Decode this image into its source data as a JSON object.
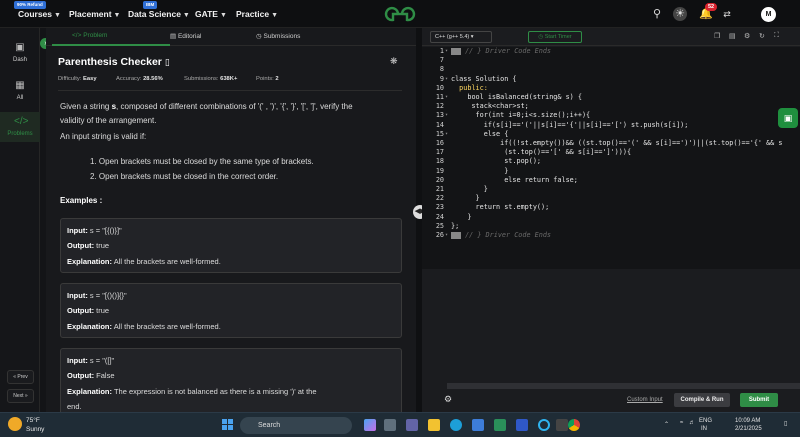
{
  "nav": {
    "courses": "Courses",
    "refund_badge": "90% Refund",
    "placement": "Placement",
    "data_science": "Data Science",
    "ibm_badge": "IBM",
    "gate": "GATE",
    "practice": "Practice",
    "notif_count": "52",
    "avatar": "M",
    "logo_text": "GfG"
  },
  "sidebar": {
    "dash": "Dash",
    "all": "All",
    "problems": "Problems",
    "prev": "« Prev",
    "next": "Next »"
  },
  "tabs": {
    "problem": "Problem",
    "editorial": "Editorial",
    "submissions": "Submissions"
  },
  "problem": {
    "title": "Parenthesis Checker",
    "difficulty_label": "Difficulty:",
    "difficulty": "Easy",
    "accuracy_label": "Accuracy:",
    "accuracy": "28.56%",
    "submissions_label": "Submissions:",
    "submissions": "638K+",
    "points_label": "Points:",
    "points": "2",
    "desc1": "Given a string",
    "desc1_var": "s",
    "desc1_rest": ", composed of different combinations of '(' , ')', '{', '}', '[', ']', verify the",
    "desc2": "validity of the arrangement.",
    "desc3": "An input string is valid if:",
    "rules": [
      "1. Open brackets must be closed by the same type of brackets.",
      "2. Open brackets must be closed in the correct order."
    ],
    "examples_heading": "Examples :",
    "examples": [
      {
        "input_label": "Input:",
        "input": "s = \"[{()}]\"",
        "output_label": "Output:",
        "output": "true",
        "expl_label": "Explanation:",
        "explanation": "All the brackets are well-formed."
      },
      {
        "input_label": "Input:",
        "input": "s = \"[()()]{}\"",
        "output_label": "Output:",
        "output": "true",
        "expl_label": "Explanation:",
        "explanation": "All the brackets are well-formed."
      },
      {
        "input_label": "Input:",
        "input": "s = \"([]\"",
        "output_label": "Output:",
        "output": "False",
        "expl_label": "Explanation:",
        "explanation": "The expression is not balanced as there is a missing ')' at the",
        "explanation2": "end."
      }
    ]
  },
  "editor": {
    "language": "C++ (g++ 5.4)",
    "timer": "Start Timer",
    "lines": [
      {
        "n": "1",
        "t": "// } Driver Code Ends",
        "cls": "cm",
        "fold": true,
        "hl": true
      },
      {
        "n": "7",
        "t": "",
        "cls": ""
      },
      {
        "n": "8",
        "t": "",
        "cls": ""
      },
      {
        "n": "9",
        "t": "class Solution {",
        "cls": "",
        "fold": true
      },
      {
        "n": "10",
        "t": "  public:",
        "cls": "kw"
      },
      {
        "n": "11",
        "t": "    bool isBalanced(string& s) {",
        "cls": "",
        "fold": true
      },
      {
        "n": "12",
        "t": "     stack<char>st;",
        "cls": ""
      },
      {
        "n": "13",
        "t": "      for(int i=0;i<s.size();i++){",
        "cls": "",
        "fold": true
      },
      {
        "n": "14",
        "t": "        if(s[i]=='('||s[i]=='{'||s[i]=='[') st.push(s[i]);",
        "cls": ""
      },
      {
        "n": "15",
        "t": "        else {",
        "cls": "",
        "fold": true
      },
      {
        "n": "16",
        "t": "            if((!st.empty())&& ((st.top()=='(' && s[i]==')')||(st.top()=='{' && s",
        "cls": ""
      },
      {
        "n": "17",
        "t": "             (st.top()=='[' && s[i]==']'))){",
        "cls": ""
      },
      {
        "n": "18",
        "t": "             st.pop();",
        "cls": ""
      },
      {
        "n": "19",
        "t": "             }",
        "cls": ""
      },
      {
        "n": "20",
        "t": "             else return false;",
        "cls": ""
      },
      {
        "n": "21",
        "t": "        }",
        "cls": ""
      },
      {
        "n": "22",
        "t": "      }",
        "cls": ""
      },
      {
        "n": "23",
        "t": "      return st.empty();",
        "cls": ""
      },
      {
        "n": "24",
        "t": "    }",
        "cls": ""
      },
      {
        "n": "25",
        "t": "};",
        "cls": ""
      },
      {
        "n": "26",
        "t": "// } Driver Code Ends",
        "cls": "cm",
        "fold": true,
        "hl": true
      }
    ],
    "custom_input": "Custom Input",
    "compile_run": "Compile & Run",
    "submit": "Submit"
  },
  "taskbar": {
    "temp": "75°F",
    "weather": "Sunny",
    "search": "Search",
    "lang1": "ENG",
    "lang2": "IN",
    "time": "10:09 AM",
    "date": "2/21/2025"
  }
}
